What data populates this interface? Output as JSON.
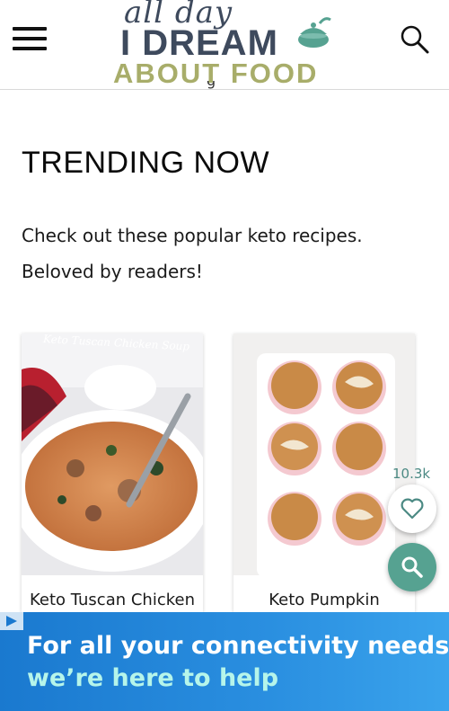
{
  "header": {
    "logo": {
      "line1": "all day",
      "line2": "I DREAM",
      "line3": "ABOUT FOOD"
    },
    "menu_icon": "hamburger-menu-icon",
    "search_icon": "search-icon"
  },
  "main": {
    "cut_off_text": "g",
    "heading": "TRENDING NOW",
    "intro": "Check out these popular keto recipes. Beloved by readers!",
    "cards": [
      {
        "title": "Keto Tuscan Chicken",
        "image_caption": "Keto Tuscan Chicken Soup"
      },
      {
        "title": "Keto Pumpkin"
      }
    ]
  },
  "floating": {
    "like_count": "10.3k",
    "like_icon": "heart-icon",
    "search_icon": "search-icon"
  },
  "ad": {
    "line1": "For all your connectivity needs,",
    "line2": "we’re here to help",
    "badge_icon": "ad-choices-icon"
  },
  "colors": {
    "brand_dark": "#3e4a5d",
    "brand_olive": "#a8ad6a",
    "accent_teal": "#56a291",
    "ad_blue": "#1a79cf"
  }
}
